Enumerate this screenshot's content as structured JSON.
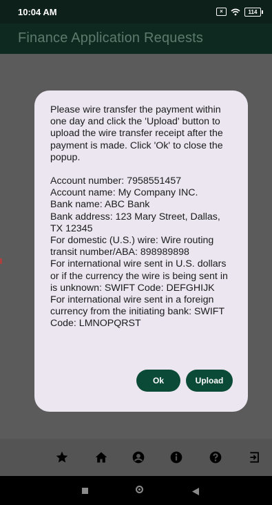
{
  "status_bar": {
    "time": "10:04 AM",
    "battery": "114"
  },
  "app_bar": {
    "title": "Finance Application Requests"
  },
  "dialog": {
    "intro": "Please wire transfer the payment within one day and click the 'Upload' button to upload the wire transfer receipt after the payment is made. Click 'Ok' to close the popup.",
    "lines": [
      "Account number: 7958551457",
      "Account name: My Company INC.",
      "Bank name: ABC Bank",
      "Bank address: 123 Mary Street, Dallas, TX 12345",
      "For domestic (U.S.) wire: Wire routing transit number/ABA: 898989898",
      "For international wire sent in U.S. dollars or if the currency the wire is being sent in is unknown: SWIFT Code: DEFGHIJK",
      "For international wire sent in a foreign currency from the initiating bank: SWIFT Code: LMNOPQRST"
    ],
    "ok_label": "Ok",
    "upload_label": "Upload"
  },
  "bottom_nav": {
    "items": [
      "star-icon",
      "home-icon",
      "account-icon",
      "info-icon",
      "help-icon",
      "logout-icon"
    ]
  },
  "colors": {
    "app_bar": "#0e2a20",
    "button": "#0b4a36",
    "dialog": "#ebe6f0"
  }
}
